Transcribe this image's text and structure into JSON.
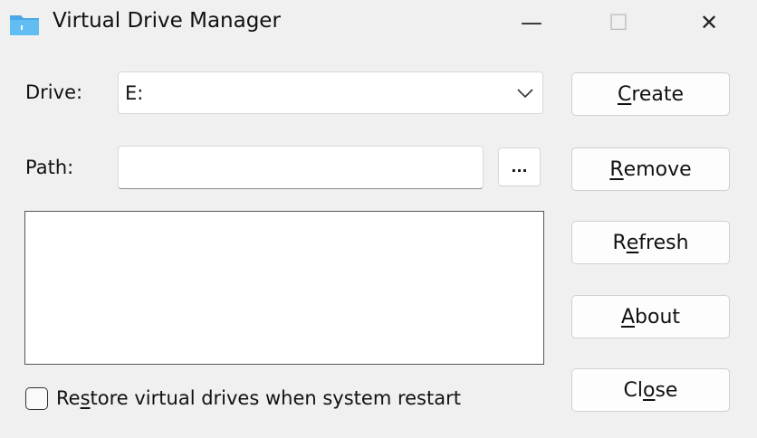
{
  "window": {
    "title": "Virtual Drive Manager",
    "minimize": "—",
    "maximize": "☐",
    "close": "✕"
  },
  "drive": {
    "label": "Drive:",
    "value": "E:"
  },
  "path": {
    "label": "Path:",
    "value": "",
    "browse": "..."
  },
  "buttons": [
    {
      "pre": "",
      "u": "C",
      "post": "reate"
    },
    {
      "pre": "",
      "u": "R",
      "post": "emove"
    },
    {
      "pre": "R",
      "u": "e",
      "post": "fresh"
    },
    {
      "pre": "",
      "u": "A",
      "post": "bout"
    },
    {
      "pre": "Cl",
      "u": "o",
      "post": "se"
    }
  ],
  "restore": {
    "pre": "Re",
    "u": "s",
    "post": "tore virtual drives when system restart",
    "checked": false
  },
  "colors": {
    "folder": "#4aa8e8"
  }
}
